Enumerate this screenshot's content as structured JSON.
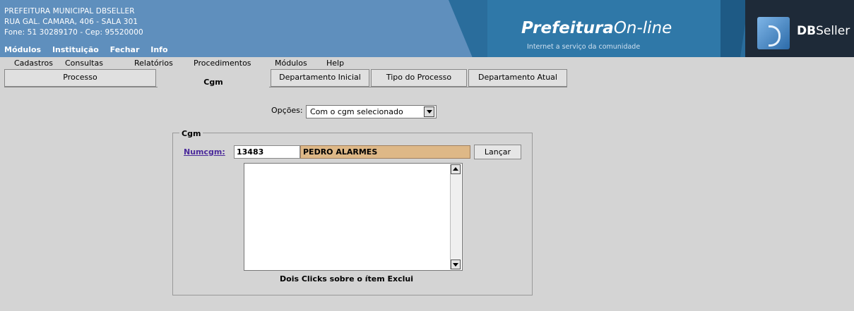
{
  "header": {
    "org_name": "PREFEITURA MUNICIPAL DBSELLER",
    "address": "RUA GAL. CAMARA, 406 - SALA 301",
    "contact": "Fone: 51 30289170  -  Cep: 95520000",
    "top_menu": [
      "Módulos",
      "Instituição",
      "Fechar",
      "Info"
    ],
    "logo_main": "Prefeitura",
    "logo_online": "On-line",
    "logo_tagline": "Internet a serviço da comunidade",
    "brand_bold": "DB",
    "brand_rest": "Seller"
  },
  "menubar": {
    "items": [
      "Cadastros",
      "Consultas",
      "Relatórios",
      "Procedimentos",
      "Módulos",
      "Help"
    ]
  },
  "tabs": [
    {
      "label": "Processo",
      "active": false
    },
    {
      "label": "Cgm",
      "active": true
    },
    {
      "label": "Departamento Inicial",
      "active": false
    },
    {
      "label": "Tipo do Processo",
      "active": false
    },
    {
      "label": "Departamento Atual",
      "active": false
    }
  ],
  "form": {
    "opcoes_label": "Opções:",
    "opcoes_value": "Com o cgm selecionado",
    "legend": "Cgm",
    "numcgm_label": "Numcgm:",
    "numcgm_value": "13483",
    "name_value": "PEDRO ALARMES",
    "lancar_label": "Lançar",
    "hint": "Dois Clicks sobre o ítem Exclui"
  },
  "colors": {
    "header_bg": "#5f8fbd",
    "page_bg": "#d4d4d4",
    "name_field_bg": "#deb887",
    "link": "#4b2a9b"
  }
}
